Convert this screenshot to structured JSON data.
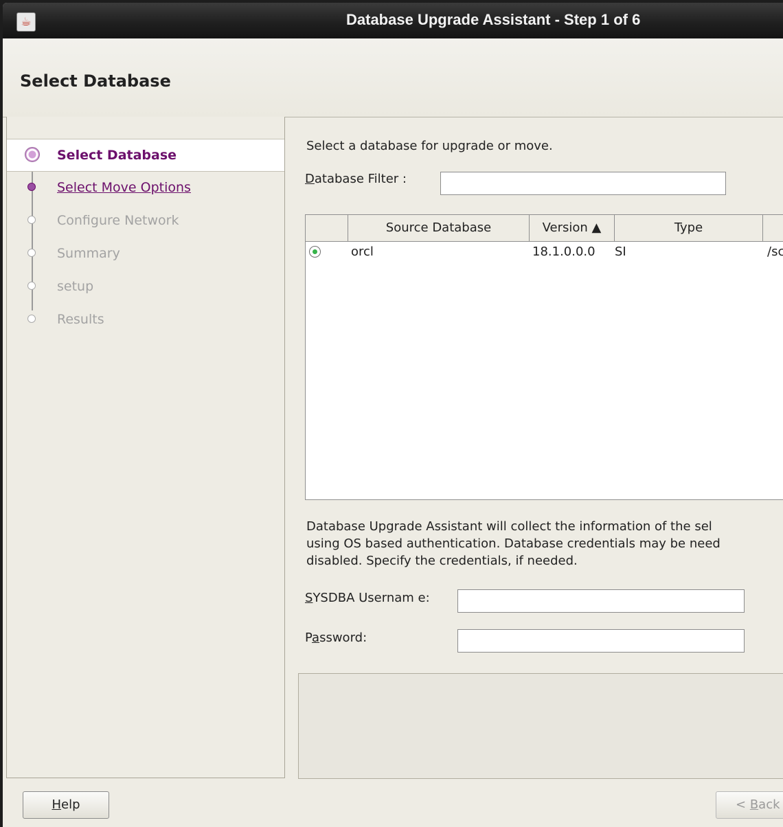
{
  "window": {
    "title": "Database Upgrade Assistant - Step 1 of 6",
    "app_icon": "java-cup-icon"
  },
  "header": {
    "page_title": "Select Database"
  },
  "sidebar": {
    "items": [
      {
        "label": "Select Database",
        "state": "current"
      },
      {
        "label": "Select Move Options",
        "state": "link"
      },
      {
        "label": "Configure Network",
        "state": "disabled"
      },
      {
        "label": "Summary",
        "state": "disabled"
      },
      {
        "label": "setup",
        "state": "disabled"
      },
      {
        "label": "Results",
        "state": "disabled"
      }
    ]
  },
  "main": {
    "intro": "Select a database for upgrade or move.",
    "filter": {
      "label_mnemonic": "D",
      "label_rest": "atabase Filter :",
      "value": ""
    },
    "table": {
      "columns": [
        "",
        "Source Database",
        "Version ▲",
        "Type",
        ""
      ],
      "rows": [
        {
          "selected": true,
          "source": "orcl",
          "version": "18.1.0.0.0",
          "type": "SI",
          "path": "/sc"
        }
      ]
    },
    "description": {
      "line1": "Database Upgrade Assistant will collect the information of the sel",
      "line2": "using OS based authentication. Database credentials may be need",
      "line3": "disabled. Specify the credentials, if needed."
    },
    "username": {
      "label_mnemonic": "S",
      "label_rest": "YSDBA Usernam e:",
      "value": ""
    },
    "password": {
      "label_pre": "P",
      "label_mnemonic": "a",
      "label_rest": "ssword:",
      "value": ""
    }
  },
  "footer": {
    "help": {
      "mnemonic": "H",
      "rest": "elp"
    },
    "back": {
      "pre": "< ",
      "mnemonic": "B",
      "rest": "ack"
    }
  },
  "colors": {
    "accent": "#6c106c",
    "background": "#eeece4",
    "titlebar": "#1e1e1e",
    "radio_selected": "#37b34a"
  }
}
